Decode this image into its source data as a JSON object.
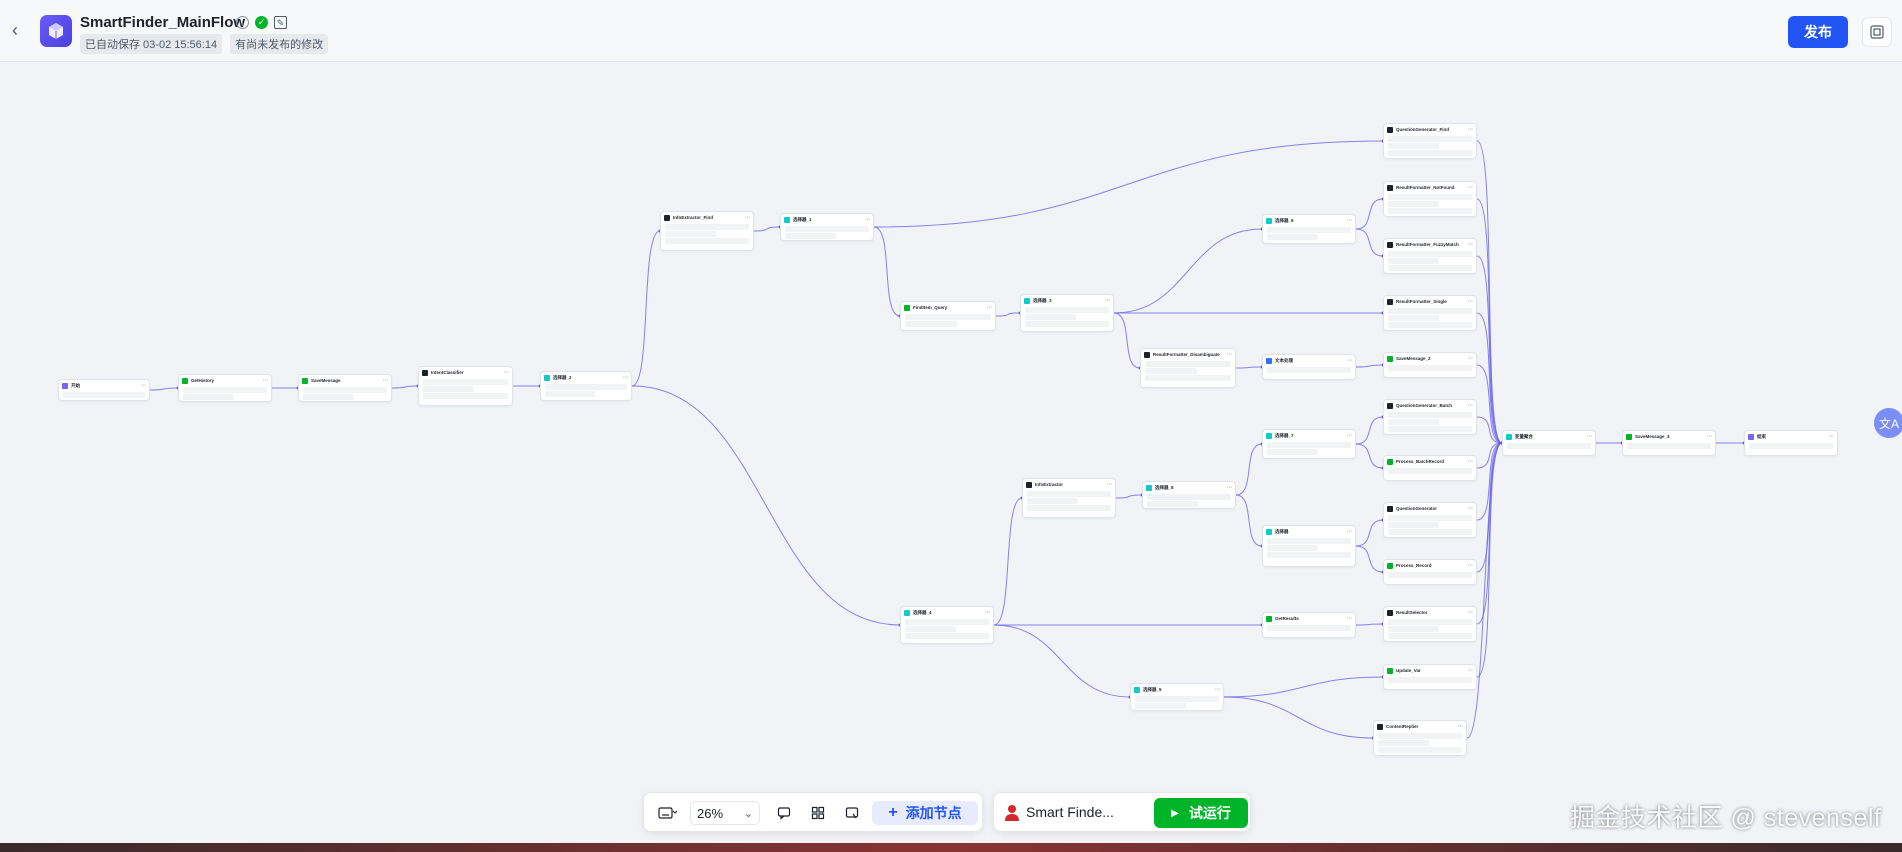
{
  "header": {
    "title": "SmartFinder_MainFlow",
    "autosave": "已自动保存 03-02 15:56:14",
    "unpublished": "有尚未发布的修改",
    "publish_label": "发布"
  },
  "canvas": {
    "nodes": [
      {
        "id": "start",
        "title": "开始",
        "icon": "purple"
      },
      {
        "id": "getintent",
        "title": "GetHistory",
        "icon": "green"
      },
      {
        "id": "savemsg1",
        "title": "SaveMessage",
        "icon": "green"
      },
      {
        "id": "intent",
        "title": "IntentClassifier",
        "icon": "dark"
      },
      {
        "id": "sel1",
        "title": "选择器_2",
        "icon": "teal"
      },
      {
        "id": "infoext",
        "title": "InfoExtractor_Find",
        "icon": "dark"
      },
      {
        "id": "sel3",
        "title": "选择器_1",
        "icon": "teal"
      },
      {
        "id": "findquery",
        "title": "FindItem_Query",
        "icon": "green"
      },
      {
        "id": "sel5",
        "title": "选择器_3",
        "icon": "teal"
      },
      {
        "id": "resdisamb",
        "title": "ResultFormatter_Disambiguate",
        "icon": "dark"
      },
      {
        "id": "textproc",
        "title": "文本处理",
        "icon": "blue"
      },
      {
        "id": "sel6",
        "title": "选择器_6",
        "icon": "teal"
      },
      {
        "id": "qgenfind",
        "title": "QuestionGenerator_Find",
        "icon": "dark"
      },
      {
        "id": "resnotfound",
        "title": "ResultFormatter_NotFound",
        "icon": "dark"
      },
      {
        "id": "resfuzzy",
        "title": "ResultFormatter_FuzzyMatch",
        "icon": "dark"
      },
      {
        "id": "ressingle",
        "title": "ResultFormatter_Single",
        "icon": "dark"
      },
      {
        "id": "savemsg2",
        "title": "SaveMessage_2",
        "icon": "green"
      },
      {
        "id": "qgenbatch",
        "title": "QuestionGenerator_Batch",
        "icon": "dark"
      },
      {
        "id": "procbatch",
        "title": "Process_BatchRecord",
        "icon": "green"
      },
      {
        "id": "qgen",
        "title": "QuestionGenerator",
        "icon": "dark"
      },
      {
        "id": "procrecord",
        "title": "Process_Record",
        "icon": "green"
      },
      {
        "id": "ressel",
        "title": "ResultSelector",
        "icon": "dark"
      },
      {
        "id": "updatevar",
        "title": "Update_Var",
        "icon": "green"
      },
      {
        "id": "contentreply",
        "title": "ContentReplier",
        "icon": "dark"
      },
      {
        "id": "sel7",
        "title": "选择器_7",
        "icon": "teal"
      },
      {
        "id": "sel8",
        "title": "选择器",
        "icon": "teal"
      },
      {
        "id": "infoext2",
        "title": "InfoExtractor",
        "icon": "dark"
      },
      {
        "id": "sel9",
        "title": "选择器_8",
        "icon": "teal"
      },
      {
        "id": "sel4",
        "title": "选择器_4",
        "icon": "teal"
      },
      {
        "id": "getresults",
        "title": "GetResults",
        "icon": "green"
      },
      {
        "id": "sel10",
        "title": "选择器_5",
        "icon": "teal"
      },
      {
        "id": "varagg",
        "title": "变量聚合",
        "icon": "teal"
      },
      {
        "id": "savemsg3",
        "title": "SaveMessage_3",
        "icon": "green"
      },
      {
        "id": "end",
        "title": "结束",
        "icon": "purple"
      }
    ]
  },
  "toolbar": {
    "zoom": "26%",
    "add_node": "添加节点"
  },
  "runbar": {
    "flow_name": "Smart Finde...",
    "run_label": "试运行"
  },
  "watermark": "掘金技术社区 @ stevenself",
  "colors": {
    "accent": "#2055f4",
    "run": "#00b42a",
    "edge": "#6b63e8"
  }
}
